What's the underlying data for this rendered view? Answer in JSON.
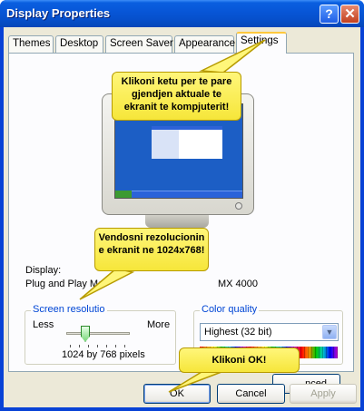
{
  "window": {
    "title": "Display Properties",
    "help_glyph": "?",
    "close_glyph": "✕"
  },
  "tabs": [
    {
      "label": "Themes"
    },
    {
      "label": "Desktop"
    },
    {
      "label": "Screen Saver"
    },
    {
      "label": "Appearance"
    },
    {
      "label": "Settings"
    }
  ],
  "callouts": {
    "monitor": "Klikoni ketu per te pare gjendjen aktuale te ekranit te kompjuterit!",
    "resolution": "Vendosni rezolucionin e ekranit ne 1024x768!",
    "ok": "Klikoni OK!"
  },
  "display": {
    "label": "Display:",
    "device_left": "Plug and Play Mo",
    "device_right": "MX 4000"
  },
  "screen_resolution": {
    "title": "Screen resolutio",
    "less": "Less",
    "more": "More",
    "value": "1024 by 768 pixels",
    "slider_fraction": 0.3
  },
  "color_quality": {
    "title": "Color quality",
    "selected": "Highest (32 bit)",
    "arrow": "▼"
  },
  "buttons": {
    "advanced": "nced",
    "ok": "OK",
    "cancel": "Cancel",
    "apply": "Apply"
  },
  "colors": {
    "title_bar": "#0842d6",
    "callout_fill": "#fff67a",
    "face": "#ece9d8",
    "accent_tab": "#ffc83c"
  }
}
